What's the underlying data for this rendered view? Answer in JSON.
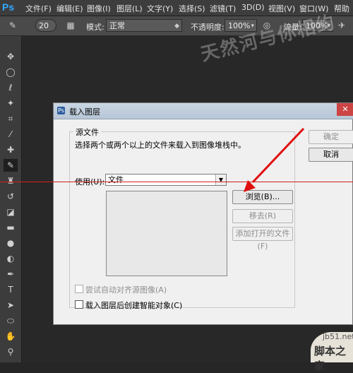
{
  "app": {
    "logo": "Ps"
  },
  "menu": [
    "文件(F)",
    "编辑(E)",
    "图像(I)",
    "图层(L)",
    "文字(Y)",
    "选择(S)",
    "滤镜(T)",
    "3D(D)",
    "视图(V)",
    "窗口(W)",
    "帮助"
  ],
  "options": {
    "brush_size": "20",
    "mode_label": "模式:",
    "mode_value": "正常",
    "opacity_label": "不透明度:",
    "opacity_value": "100%",
    "flow_label": "流量:",
    "flow_value": "100%"
  },
  "tools": [
    "move-icon",
    "marquee-icon",
    "lasso-icon",
    "magic-wand-icon",
    "crop-icon",
    "eyedropper-icon",
    "healing-icon",
    "brush-icon",
    "stamp-icon",
    "history-brush-icon",
    "eraser-icon",
    "gradient-icon",
    "blur-icon",
    "dodge-icon",
    "pen-icon",
    "type-icon",
    "path-select-icon",
    "shape-icon",
    "hand-icon",
    "zoom-icon"
  ],
  "watermark": "天然河与你相约",
  "dialog": {
    "title": "载入图层",
    "source_group": "源文件",
    "source_desc": "选择两个或两个以上的文件来载入到图像堆栈中。",
    "use_label": "使用(U):",
    "use_value": "文件",
    "ok": "确定",
    "cancel": "取消",
    "browse": "浏览(B)...",
    "remove": "移去(R)",
    "add_open": "添加打开的文件(F)",
    "auto_align": "尝试自动对齐源图像(A)",
    "smart_object": "载入图层后创建智能对象(C)"
  },
  "site": {
    "url": "jb51.net",
    "name": "脚本之家"
  }
}
